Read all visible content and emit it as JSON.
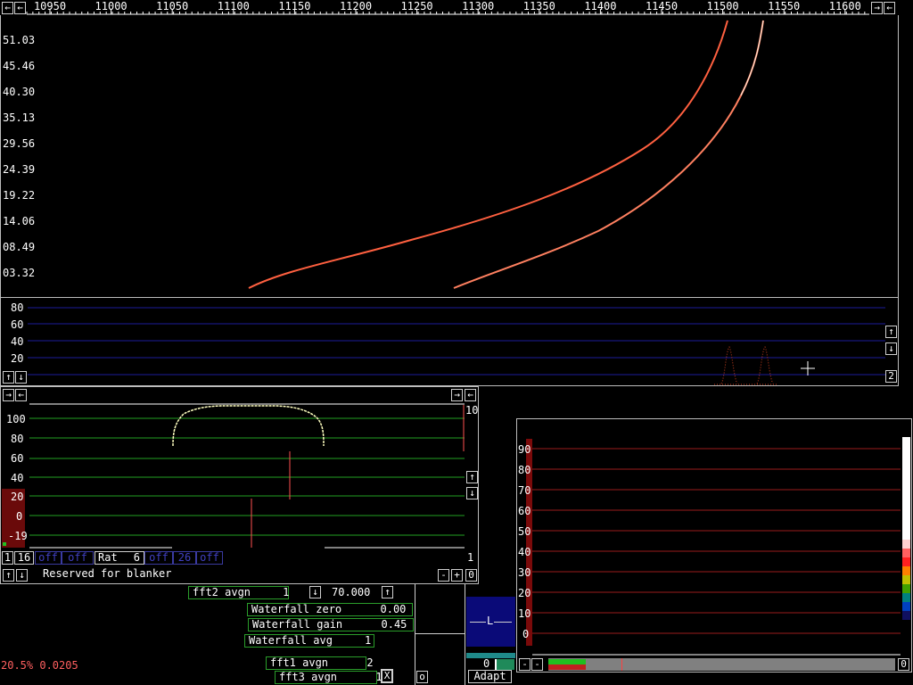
{
  "freq_axis": {
    "ticks": [
      "10950",
      "11000",
      "11050",
      "11100",
      "11150",
      "11200",
      "11250",
      "11300",
      "11350",
      "11400",
      "11450",
      "11500",
      "11550",
      "11600"
    ]
  },
  "waterfall": {
    "y_labels": [
      "51.03",
      "45.46",
      "40.30",
      "35.13",
      "29.56",
      "24.39",
      "19.22",
      "14.06",
      "08.49",
      "03.32"
    ]
  },
  "spectrum": {
    "y_labels": [
      "80",
      "60",
      "40",
      "20"
    ],
    "right_button": "2"
  },
  "blanker": {
    "y_labels": [
      "100",
      "80",
      "60",
      "40",
      "20",
      "0",
      "-19"
    ],
    "right_value": "10",
    "param_1": "1",
    "param_16": "16",
    "off1": "off",
    "off2": "off",
    "rat_label": "Rat",
    "rat_value": "6",
    "off3": "off",
    "val_26": "26",
    "off4": "off",
    "right_1": "1",
    "reserved_text": "Reserved for blanker",
    "minus": "-",
    "plus": "+",
    "zero": "0"
  },
  "controls": {
    "fft2_avgn": "fft2 avgn     1",
    "value_70": "70.000",
    "wf_zero": "Waterfall zero      0.00",
    "wf_gain": "Waterfall gain      0.45",
    "wf_avg": "Waterfall avg     1",
    "fft1_avgn": "fft1 avgn      2",
    "fft3_avgn": "fft3 avgn      1",
    "x_button": "X",
    "o_button": "o",
    "status_text": "20.5% 0.0205"
  },
  "meter": {
    "l_label": "L",
    "zero": "0",
    "adapt": "Adapt"
  },
  "smeter": {
    "y_labels": [
      "90",
      "80",
      "70",
      "60",
      "50",
      "40",
      "30",
      "20",
      "10",
      "0"
    ],
    "minus1": "-",
    "minus2": "-",
    "zero": "0"
  },
  "colors": {
    "trace": "#ff6040",
    "grid_blue": "#1c1c9a",
    "grid_green": "#22a022",
    "grid_red": "#9a1c1c",
    "panel_border": "#bdbdbd"
  }
}
